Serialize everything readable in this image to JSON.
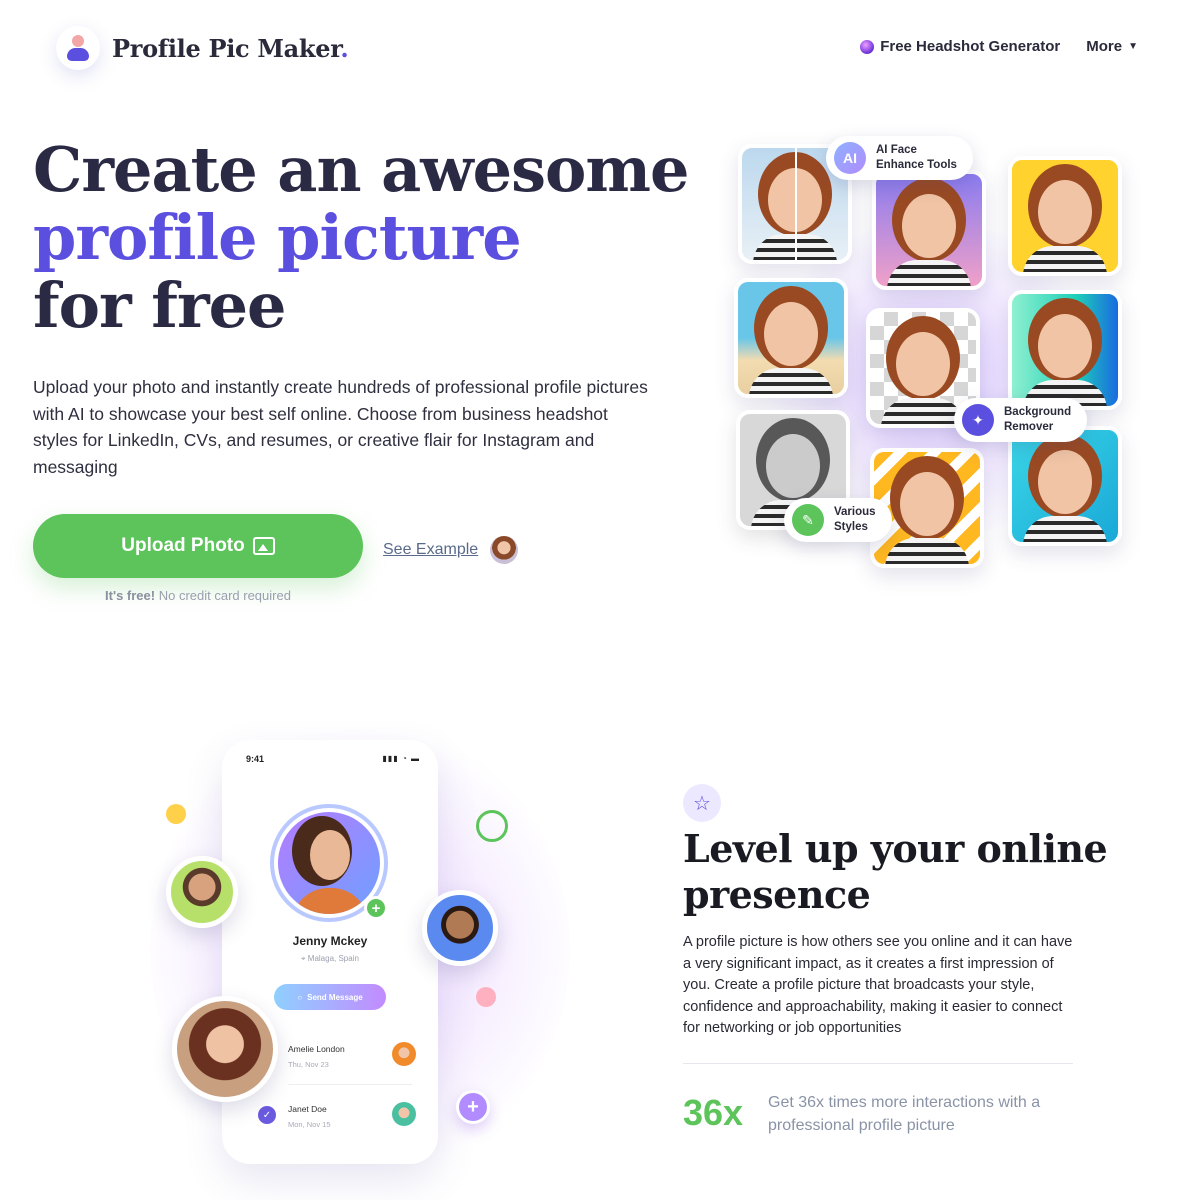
{
  "header": {
    "logo_text": "Profile Pic Maker",
    "logo_dot": ".",
    "nav": [
      {
        "label": "Free Headshot Generator",
        "icon": "gem-icon"
      },
      {
        "label": "More",
        "icon": "caret-down-icon"
      }
    ]
  },
  "hero": {
    "title_line1": "Create an awesome",
    "title_line2": "profile picture",
    "title_line3": "for free",
    "description": "Upload your photo and instantly create hundreds of professional profile pictures with AI to showcase your best self online. Choose from business headshot styles for LinkedIn, CVs, and resumes, or creative flair for Instagram and messaging",
    "upload_label": "Upload Photo",
    "see_example_label": "See Example",
    "free_bold": "It's free!",
    "free_rest": " No credit card required"
  },
  "collage": {
    "chips": [
      {
        "icon_text": "AI",
        "line1": "AI Face",
        "line2": "Enhance Tools"
      },
      {
        "icon_text": "✦",
        "line1": "Background",
        "line2": "Remover"
      },
      {
        "icon_text": "✎",
        "line1": "Various",
        "line2": "Styles"
      }
    ]
  },
  "phone": {
    "time": "9:41",
    "name": "Jenny Mckey",
    "location": "Malaga, Spain",
    "send_label": "Send Message",
    "contacts": [
      {
        "name": "Amelie London",
        "date": "Thu, Nov 23"
      },
      {
        "name": "Janet Doe",
        "date": "Mon, Nov 15"
      }
    ]
  },
  "section2": {
    "title_line1": "Level up your online",
    "title_line2": "presence",
    "description": "A profile picture is how others see you online and it can have a very significant impact, as it creates a first impression of you. Create a profile picture that broadcasts your style, confidence and approachability, making it easier to connect for networking or job opportunities",
    "stat_value": "36x",
    "stat_text": "Get 36x times more interactions with a professional profile picture"
  },
  "colors": {
    "accent": "#5b4fe0",
    "green": "#5cc45a",
    "dark": "#2a2a45"
  }
}
